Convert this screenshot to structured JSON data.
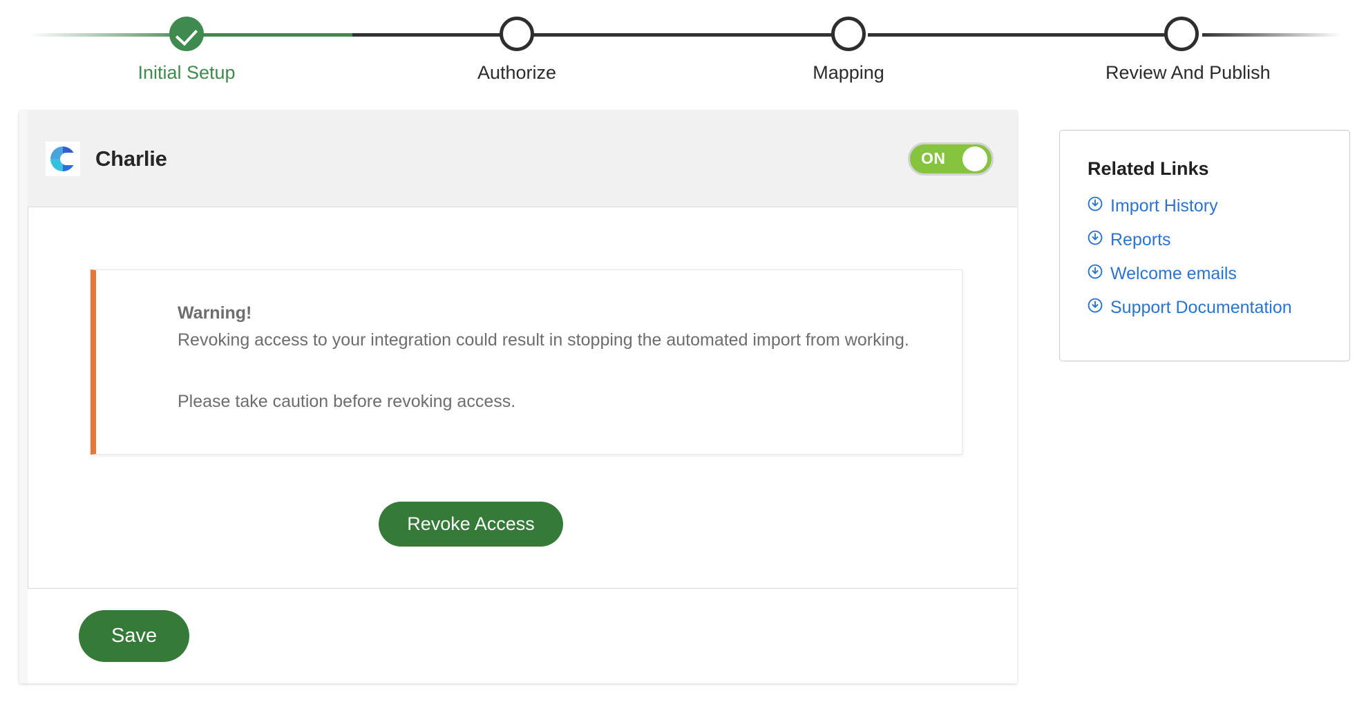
{
  "stepper": {
    "steps": [
      {
        "label": "Initial Setup",
        "state": "done"
      },
      {
        "label": "Authorize",
        "state": "todo"
      },
      {
        "label": "Mapping",
        "state": "todo"
      },
      {
        "label": "Review And Publish",
        "state": "todo"
      }
    ],
    "active_color": "#3f8a4e",
    "inactive_color": "#2e2e2e"
  },
  "card": {
    "integration_name": "Charlie",
    "logo_icon": "charlie-logo-icon",
    "toggle": {
      "label": "ON",
      "state": "on",
      "on_color": "#86c440"
    },
    "warning": {
      "title": "Warning!",
      "line1": "Revoking access to your integration could result in stopping the automated import from working.",
      "line2": "Please take caution before revoking access.",
      "accent_color": "#e8763a"
    },
    "revoke_button": "Revoke Access",
    "save_button": "Save",
    "button_color": "#357a38"
  },
  "related_links": {
    "title": "Related Links",
    "link_color": "#2a74d0",
    "items": [
      {
        "label": "Import History",
        "icon": "download-circle-icon"
      },
      {
        "label": "Reports",
        "icon": "download-circle-icon"
      },
      {
        "label": "Welcome emails",
        "icon": "download-circle-icon"
      },
      {
        "label": "Support Documentation",
        "icon": "download-circle-icon"
      }
    ]
  }
}
